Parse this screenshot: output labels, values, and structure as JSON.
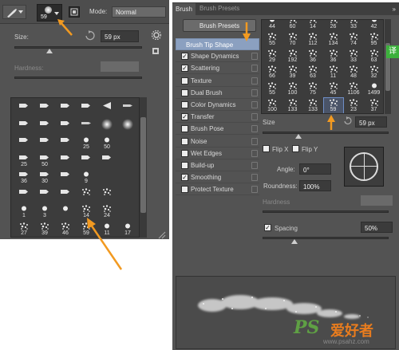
{
  "options_bar": {
    "brush_size": "59",
    "mode_label": "Mode:",
    "mode_value": "Normal"
  },
  "left_panel": {
    "size_label": "Size:",
    "size_value": "59 px",
    "hardness_label": "Hardness:",
    "presets": [
      {
        "n": "",
        "shape": "flat"
      },
      {
        "n": "",
        "shape": "flat"
      },
      {
        "n": "",
        "shape": "flat"
      },
      {
        "n": "",
        "shape": "flat"
      },
      {
        "n": "",
        "shape": "fan"
      },
      {
        "n": "",
        "shape": "pen"
      },
      {
        "n": "",
        "shape": "flat"
      },
      {
        "n": "",
        "shape": "flat"
      },
      {
        "n": "",
        "shape": "flat"
      },
      {
        "n": "",
        "shape": "pen"
      },
      {
        "n": "",
        "shape": "soft"
      },
      {
        "n": "",
        "shape": "soft"
      },
      {
        "n": "",
        "shape": "flat"
      },
      {
        "n": "",
        "shape": "flat"
      },
      {
        "n": "",
        "shape": "flat"
      },
      {
        "n": "25",
        "shape": "round"
      },
      {
        "n": "50",
        "shape": "round"
      },
      {
        "n": "",
        "shape": ""
      },
      {
        "n": "25",
        "shape": "flat"
      },
      {
        "n": "50",
        "shape": "flat"
      },
      {
        "n": "",
        "shape": "flat"
      },
      {
        "n": "",
        "shape": "flat"
      },
      {
        "n": "",
        "shape": "flat"
      },
      {
        "n": "",
        "shape": ""
      },
      {
        "n": "36",
        "shape": "flat"
      },
      {
        "n": "30",
        "shape": "flat"
      },
      {
        "n": "",
        "shape": "flat"
      },
      {
        "n": "9",
        "shape": "round"
      },
      {
        "n": "",
        "shape": ""
      },
      {
        "n": "",
        "shape": ""
      },
      {
        "n": "",
        "shape": "flat"
      },
      {
        "n": "",
        "shape": "flat"
      },
      {
        "n": "",
        "shape": "flat"
      },
      {
        "n": "",
        "shape": "scatter"
      },
      {
        "n": "",
        "shape": "scatter"
      },
      {
        "n": "",
        "shape": ""
      },
      {
        "n": "1",
        "shape": "round"
      },
      {
        "n": "3",
        "shape": "round"
      },
      {
        "n": "",
        "shape": "round"
      },
      {
        "n": "14",
        "shape": "scatter"
      },
      {
        "n": "24",
        "shape": "scatter"
      },
      {
        "n": "",
        "shape": ""
      },
      {
        "n": "27",
        "shape": "scatter"
      },
      {
        "n": "39",
        "shape": "scatter"
      },
      {
        "n": "46",
        "shape": "scatter"
      },
      {
        "n": "59",
        "shape": "scatter"
      },
      {
        "n": "11",
        "shape": "round"
      },
      {
        "n": "17",
        "shape": "round"
      }
    ]
  },
  "right_panel": {
    "tabs": [
      "Brush",
      "Brush Presets"
    ],
    "menu_icon": "»",
    "brush_presets_button": "Brush Presets",
    "options": [
      {
        "label": "Brush Tip Shape",
        "checked": null,
        "active": true
      },
      {
        "label": "Shape Dynamics",
        "checked": true
      },
      {
        "label": "Scattering",
        "checked": true
      },
      {
        "label": "Texture",
        "checked": false
      },
      {
        "label": "Dual Brush",
        "checked": false
      },
      {
        "label": "Color Dynamics",
        "checked": false
      },
      {
        "label": "Transfer",
        "checked": true
      },
      {
        "label": "Brush Pose",
        "checked": false
      },
      {
        "label": "Noise",
        "checked": false
      },
      {
        "label": "Wet Edges",
        "checked": false
      },
      {
        "label": "Build-up",
        "checked": false
      },
      {
        "label": "Smoothing",
        "checked": true
      },
      {
        "label": "Protect Texture",
        "checked": false
      }
    ],
    "presets": [
      {
        "n": "44",
        "shape": "round"
      },
      {
        "n": "60",
        "shape": "scatter"
      },
      {
        "n": "14",
        "shape": "scatter"
      },
      {
        "n": "26",
        "shape": "scatter"
      },
      {
        "n": "33",
        "shape": "scatter"
      },
      {
        "n": "42",
        "shape": "round"
      },
      {
        "n": "55",
        "shape": "scatter"
      },
      {
        "n": "70",
        "shape": "scatter"
      },
      {
        "n": "112",
        "shape": "scatter"
      },
      {
        "n": "134",
        "shape": "scatter"
      },
      {
        "n": "74",
        "shape": "scatter"
      },
      {
        "n": "95",
        "shape": "scatter"
      },
      {
        "n": "29",
        "shape": "scatter"
      },
      {
        "n": "192",
        "shape": "scatter"
      },
      {
        "n": "36",
        "shape": "scatter"
      },
      {
        "n": "36",
        "shape": "scatter"
      },
      {
        "n": "33",
        "shape": "scatter"
      },
      {
        "n": "63",
        "shape": "scatter"
      },
      {
        "n": "66",
        "shape": "scatter"
      },
      {
        "n": "39",
        "shape": "scatter"
      },
      {
        "n": "63",
        "shape": "scatter"
      },
      {
        "n": "11",
        "shape": "scatter"
      },
      {
        "n": "48",
        "shape": "scatter"
      },
      {
        "n": "32",
        "shape": "scatter"
      },
      {
        "n": "55",
        "shape": "scatter"
      },
      {
        "n": "100",
        "shape": "scatter"
      },
      {
        "n": "75",
        "shape": "scatter"
      },
      {
        "n": "45",
        "shape": "scatter"
      },
      {
        "n": "1106",
        "shape": "scatter"
      },
      {
        "n": "1499",
        "shape": "round"
      },
      {
        "n": "100",
        "shape": "scatter"
      },
      {
        "n": "133",
        "shape": "scatter"
      },
      {
        "n": "133",
        "shape": "scatter"
      },
      {
        "n": "59",
        "shape": "scatter"
      },
      {
        "n": "23",
        "shape": "scatter"
      },
      {
        "n": "37",
        "shape": "scatter"
      }
    ],
    "size_label": "Size",
    "size_value": "59 px",
    "flip_x": "Flip X",
    "flip_y": "Flip Y",
    "angle_label": "Angle:",
    "angle_value": "0°",
    "roundness_label": "Roundness:",
    "roundness_value": "100%",
    "hardness_label": "Hardness",
    "spacing_label": "Spacing",
    "spacing_value": "50%"
  },
  "watermark": {
    "logo": "PS",
    "text": "爱好者",
    "url": "www.psahz.com"
  },
  "side_tab": "译"
}
